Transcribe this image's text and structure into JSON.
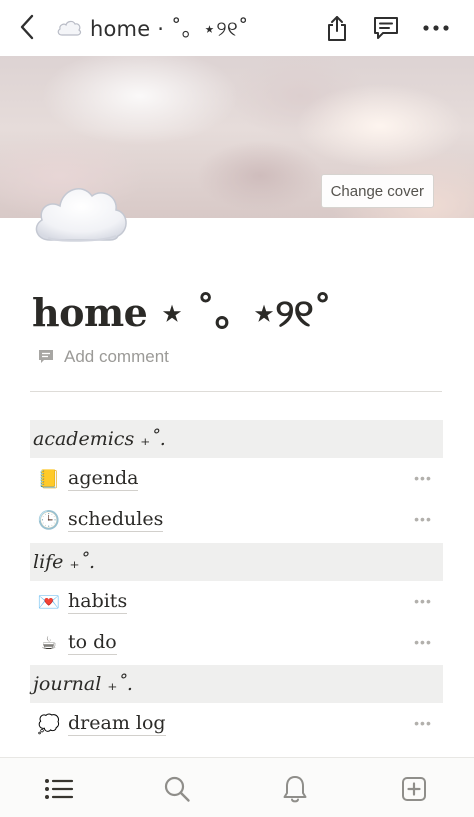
{
  "topbar": {
    "back_icon": "chevron-left-icon",
    "crumb_icon": "☁️",
    "crumb_title": "home · ˚。⋆୨୧˚",
    "share_icon": "share-icon",
    "comments_icon": "comments-icon",
    "more_icon": "more-icon"
  },
  "cover": {
    "change_label": "Change cover"
  },
  "page": {
    "icon": "cloud-icon",
    "title": "home ⋆ ˚。⋆୨୧˚",
    "add_comment": "Add comment"
  },
  "sections": [
    {
      "label": "academics ₊˚.",
      "items": [
        {
          "icon": "📒",
          "label": "agenda"
        },
        {
          "icon": "🕒",
          "label": "schedules"
        }
      ]
    },
    {
      "label": "life ₊˚.",
      "items": [
        {
          "icon": "💌",
          "label": "habits"
        },
        {
          "icon": "☕",
          "label": "to do"
        }
      ]
    },
    {
      "label": "journal ₊˚.",
      "items": [
        {
          "icon": "💭",
          "label": "dream log"
        }
      ]
    }
  ],
  "more_glyph": "•••",
  "bottombar": {
    "tabs": [
      "list-icon",
      "search-icon",
      "bell-icon",
      "add-page-icon"
    ]
  },
  "colors": {
    "section_bg": "#efefee",
    "text": "#2b2a27",
    "muted": "#9b9a97"
  }
}
